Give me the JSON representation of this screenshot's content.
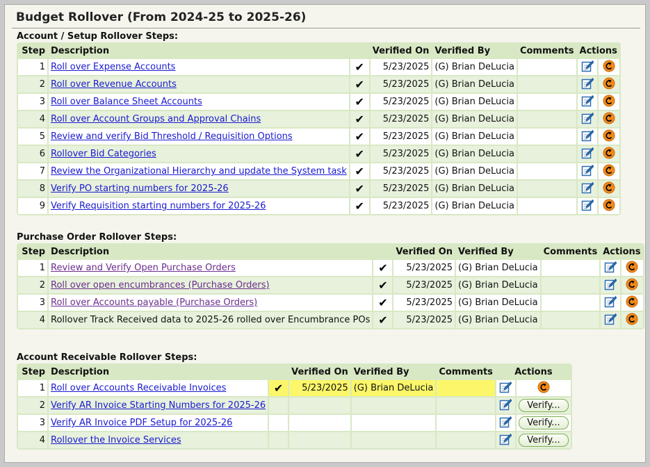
{
  "page_title": "Budget Rollover (From 2024-25 to 2025-26)",
  "sections": [
    {
      "title": "Account / Setup Rollover Steps:",
      "headers": {
        "step": "Step",
        "description": "Description",
        "verified_on": "Verified On",
        "verified_by": "Verified By",
        "comments": "Comments",
        "actions": "Actions"
      },
      "rows": [
        {
          "step": "1",
          "description": "Roll over Expense Accounts",
          "link": true,
          "checked": true,
          "verified_on": "5/23/2025",
          "verified_by": "(G) Brian DeLucia",
          "comments": "",
          "action": "undo"
        },
        {
          "step": "2",
          "description": "Roll over Revenue Accounts",
          "link": true,
          "checked": true,
          "verified_on": "5/23/2025",
          "verified_by": "(G) Brian DeLucia",
          "comments": "",
          "action": "undo"
        },
        {
          "step": "3",
          "description": "Roll over Balance Sheet Accounts",
          "link": true,
          "checked": true,
          "verified_on": "5/23/2025",
          "verified_by": "(G) Brian DeLucia",
          "comments": "",
          "action": "undo"
        },
        {
          "step": "4",
          "description": "Roll over Account Groups and Approval Chains",
          "link": true,
          "checked": true,
          "verified_on": "5/23/2025",
          "verified_by": "(G) Brian DeLucia",
          "comments": "",
          "action": "undo"
        },
        {
          "step": "5",
          "description": "Review and verify Bid Threshold / Requisition Options",
          "link": true,
          "checked": true,
          "verified_on": "5/23/2025",
          "verified_by": "(G) Brian DeLucia",
          "comments": "",
          "action": "undo"
        },
        {
          "step": "6",
          "description": "Rollover Bid Categories",
          "link": true,
          "checked": true,
          "verified_on": "5/23/2025",
          "verified_by": "(G) Brian DeLucia",
          "comments": "",
          "action": "undo"
        },
        {
          "step": "7",
          "description": "Review the Organizational Hierarchy and update the System task",
          "link": true,
          "checked": true,
          "verified_on": "5/23/2025",
          "verified_by": "(G) Brian DeLucia",
          "comments": "",
          "action": "undo"
        },
        {
          "step": "8",
          "description": "Verify PO starting numbers for 2025-26",
          "link": true,
          "checked": true,
          "verified_on": "5/23/2025",
          "verified_by": "(G) Brian DeLucia",
          "comments": "",
          "action": "undo"
        },
        {
          "step": "9",
          "description": "Verify Requisition starting numbers for 2025-26",
          "link": true,
          "checked": true,
          "verified_on": "5/23/2025",
          "verified_by": "(G) Brian DeLucia",
          "comments": "",
          "action": "undo"
        }
      ]
    },
    {
      "title": "Purchase Order Rollover Steps:",
      "headers": {
        "step": "Step",
        "description": "Description",
        "verified_on": "Verified On",
        "verified_by": "Verified By",
        "comments": "Comments",
        "actions": "Actions"
      },
      "rows": [
        {
          "step": "1",
          "description": "Review and Verify Open Purchase Orders",
          "link": true,
          "visited": true,
          "checked": true,
          "verified_on": "5/23/2025",
          "verified_by": "(G) Brian DeLucia",
          "comments": "",
          "action": "undo"
        },
        {
          "step": "2",
          "description": "Roll over open encumbrances (Purchase Orders)",
          "link": true,
          "visited": true,
          "checked": true,
          "verified_on": "5/23/2025",
          "verified_by": "(G) Brian DeLucia",
          "comments": "",
          "action": "undo"
        },
        {
          "step": "3",
          "description": "Roll over Accounts payable (Purchase Orders)",
          "link": true,
          "visited": true,
          "checked": true,
          "verified_on": "5/23/2025",
          "verified_by": "(G) Brian DeLucia",
          "comments": "",
          "action": "undo"
        },
        {
          "step": "4",
          "description": "Rollover Track Received data to 2025-26 rolled over Encumbrance POs",
          "link": false,
          "checked": true,
          "verified_on": "5/23/2025",
          "verified_by": "(G) Brian DeLucia",
          "comments": "",
          "action": "undo"
        }
      ]
    },
    {
      "title": "Account Receivable Rollover Steps:",
      "headers": {
        "step": "Step",
        "description": "Description",
        "verified_on": "Verified On",
        "verified_by": "Verified By",
        "comments": "Comments",
        "actions": "Actions"
      },
      "rows": [
        {
          "step": "1",
          "description": "Roll over Accounts Receivable Invoices",
          "link": true,
          "checked": true,
          "highlight": true,
          "verified_on": "5/23/2025",
          "verified_by": "(G) Brian DeLucia",
          "comments": "",
          "action": "undo"
        },
        {
          "step": "2",
          "description": "Verify AR Invoice Starting Numbers for 2025-26",
          "link": true,
          "checked": false,
          "verified_on": "",
          "verified_by": "",
          "comments": "",
          "action": "verify"
        },
        {
          "step": "3",
          "description": "Verify AR Invoice PDF Setup for 2025-26",
          "link": true,
          "checked": false,
          "verified_on": "",
          "verified_by": "",
          "comments": "",
          "action": "verify"
        },
        {
          "step": "4",
          "description": "Rollover the Invoice Services",
          "link": true,
          "checked": false,
          "verified_on": "",
          "verified_by": "",
          "comments": "",
          "action": "verify"
        }
      ]
    }
  ],
  "labels": {
    "check_mark": "✔",
    "verify_button": "Verify..."
  },
  "icons": {
    "edit": "edit-icon",
    "undo": "undo-icon",
    "check": "check-icon"
  },
  "colors": {
    "header_band": "#d8e8c4",
    "row_alt": "#e7f1dc",
    "link": "#1a1ad0",
    "visited_link": "#6b2d8e",
    "highlight": "#fcf76a",
    "undo_orange": "#f08a1c"
  }
}
